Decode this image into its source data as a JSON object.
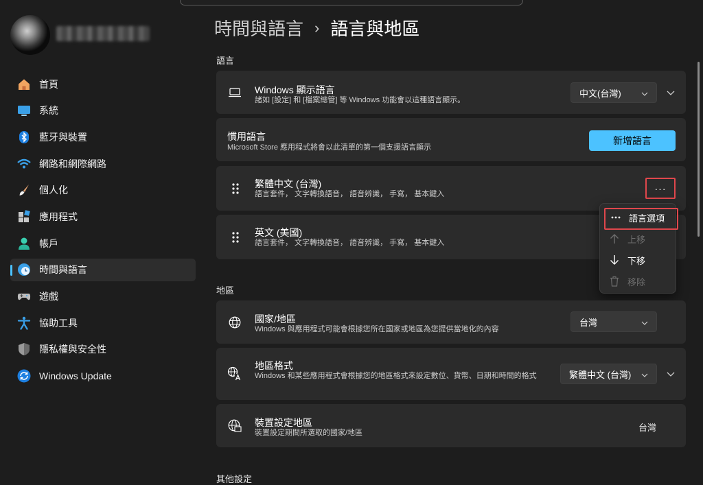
{
  "sidebar": {
    "items": [
      {
        "label": "首頁",
        "icon": "home-icon"
      },
      {
        "label": "系統",
        "icon": "system-icon"
      },
      {
        "label": "藍牙與裝置",
        "icon": "bluetooth-icon"
      },
      {
        "label": "網路和網際網路",
        "icon": "wifi-icon"
      },
      {
        "label": "個人化",
        "icon": "brush-icon"
      },
      {
        "label": "應用程式",
        "icon": "apps-icon"
      },
      {
        "label": "帳戶",
        "icon": "account-icon"
      },
      {
        "label": "時間與語言",
        "icon": "time-language-icon",
        "active": true
      },
      {
        "label": "遊戲",
        "icon": "gamepad-icon"
      },
      {
        "label": "協助工具",
        "icon": "accessibility-icon"
      },
      {
        "label": "隱私權與安全性",
        "icon": "shield-icon"
      },
      {
        "label": "Windows Update",
        "icon": "windows-update-icon"
      }
    ]
  },
  "breadcrumb": {
    "parent": "時間與語言",
    "separator": "›",
    "current": "語言與地區"
  },
  "language_section": {
    "label": "語言",
    "display_language": {
      "title": "Windows 顯示語言",
      "desc": "諸如 [設定] 和 [檔案總管] 等 Windows 功能會以這種語言顯示。",
      "value": "中文(台灣)"
    },
    "preferred": {
      "title": "慣用語言",
      "desc": "Microsoft Store 應用程式將會以此清單的第一個支援語言顯示",
      "button": "新增語言"
    },
    "languages": [
      {
        "name": "繁體中文 (台灣)",
        "features": "語言套件， 文字轉換語音， 語音辨識， 手寫， 基本鍵入"
      },
      {
        "name": "英文 (美國)",
        "features": "語言套件， 文字轉換語音， 語音辨識， 手寫， 基本鍵入"
      }
    ],
    "more_label": "···"
  },
  "context_menu": {
    "items": [
      {
        "label": "語言選項",
        "icon": "more-icon",
        "enabled": true
      },
      {
        "label": "上移",
        "icon": "arrow-up-icon",
        "enabled": false
      },
      {
        "label": "下移",
        "icon": "arrow-down-icon",
        "enabled": true
      },
      {
        "label": "移除",
        "icon": "trash-icon",
        "enabled": false
      }
    ]
  },
  "region_section": {
    "label": "地區",
    "country": {
      "title": "國家/地區",
      "desc": "Windows 與應用程式可能會根據您所在國家或地區為您提供當地化的內容",
      "value": "台灣"
    },
    "format": {
      "title": "地區格式",
      "desc": "Windows 和某些應用程式會根據您的地區格式來設定數位、貨幣、日期和時間的格式",
      "value": "繁體中文 (台灣)"
    },
    "device_region": {
      "title": "裝置設定地區",
      "desc": "裝置設定期間所選取的國家/地區",
      "value": "台灣"
    }
  },
  "other_section": {
    "label": "其他設定"
  },
  "colors": {
    "accent": "#4cc2ff",
    "highlight": "#e0474c"
  }
}
